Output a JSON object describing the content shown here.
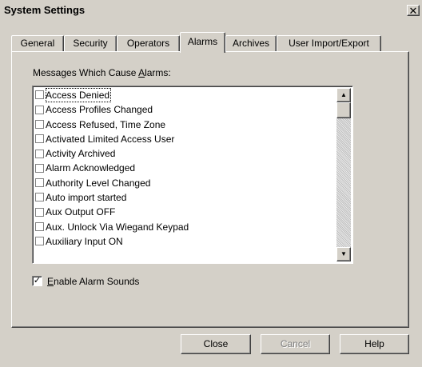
{
  "window": {
    "title": "System Settings",
    "close_glyph": "✕"
  },
  "tabs": [
    {
      "label": "General",
      "active": false
    },
    {
      "label": "Security",
      "active": false
    },
    {
      "label": "Operators",
      "active": false
    },
    {
      "label": "Alarms",
      "active": true
    },
    {
      "label": "Archives",
      "active": false
    },
    {
      "label": "User Import/Export",
      "active": false
    }
  ],
  "alarms": {
    "list_label_pre": "Messages Which Cause ",
    "list_label_accel": "A",
    "list_label_post": "larms:",
    "items": [
      {
        "label": "Access Denied",
        "checked": false,
        "focused": true
      },
      {
        "label": "Access Profiles Changed",
        "checked": false
      },
      {
        "label": "Access Refused, Time Zone",
        "checked": false
      },
      {
        "label": "Activated Limited Access User",
        "checked": false
      },
      {
        "label": "Activity Archived",
        "checked": false
      },
      {
        "label": "Alarm Acknowledged",
        "checked": false
      },
      {
        "label": "Authority Level Changed",
        "checked": false
      },
      {
        "label": "Auto import started",
        "checked": false
      },
      {
        "label": "Aux Output OFF",
        "checked": false
      },
      {
        "label": "Aux. Unlock Via Wiegand Keypad",
        "checked": false
      },
      {
        "label": "Auxiliary Input ON",
        "checked": false
      }
    ],
    "scroll_up_glyph": "▲",
    "scroll_down_glyph": "▼",
    "enable_sounds": {
      "checked": true,
      "check_glyph": "✓",
      "label_accel": "E",
      "label_rest": "nable Alarm Sounds"
    }
  },
  "buttons": {
    "close": "Close",
    "cancel": "Cancel",
    "help": "Help"
  }
}
